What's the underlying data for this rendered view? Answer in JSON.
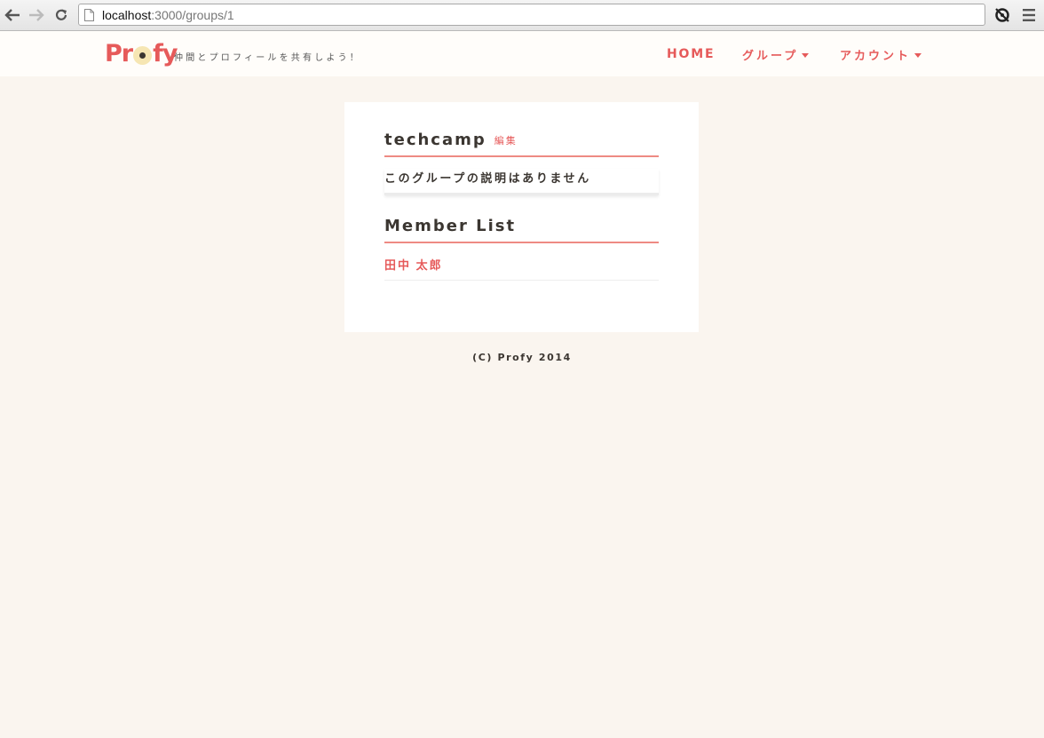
{
  "browser": {
    "url_host": "localhost",
    "url_rest": ":3000/groups/1"
  },
  "header": {
    "logo": {
      "p": "Pr",
      "after": "fy"
    },
    "tagline": "仲間とプロフィールを共有しよう！",
    "nav": {
      "home": "HOME",
      "groups": "グループ",
      "account": "アカウント"
    }
  },
  "group": {
    "name": "techcamp",
    "edit_label": "編集",
    "description": "このグループの説明はありません"
  },
  "members": {
    "heading": "Member List",
    "items": [
      {
        "name": "田中 太郎"
      }
    ]
  },
  "footer": {
    "text": "(C) Profy 2014"
  },
  "colors": {
    "accent": "#e65a5a",
    "background": "#faf5ef",
    "text": "#3b3631"
  }
}
